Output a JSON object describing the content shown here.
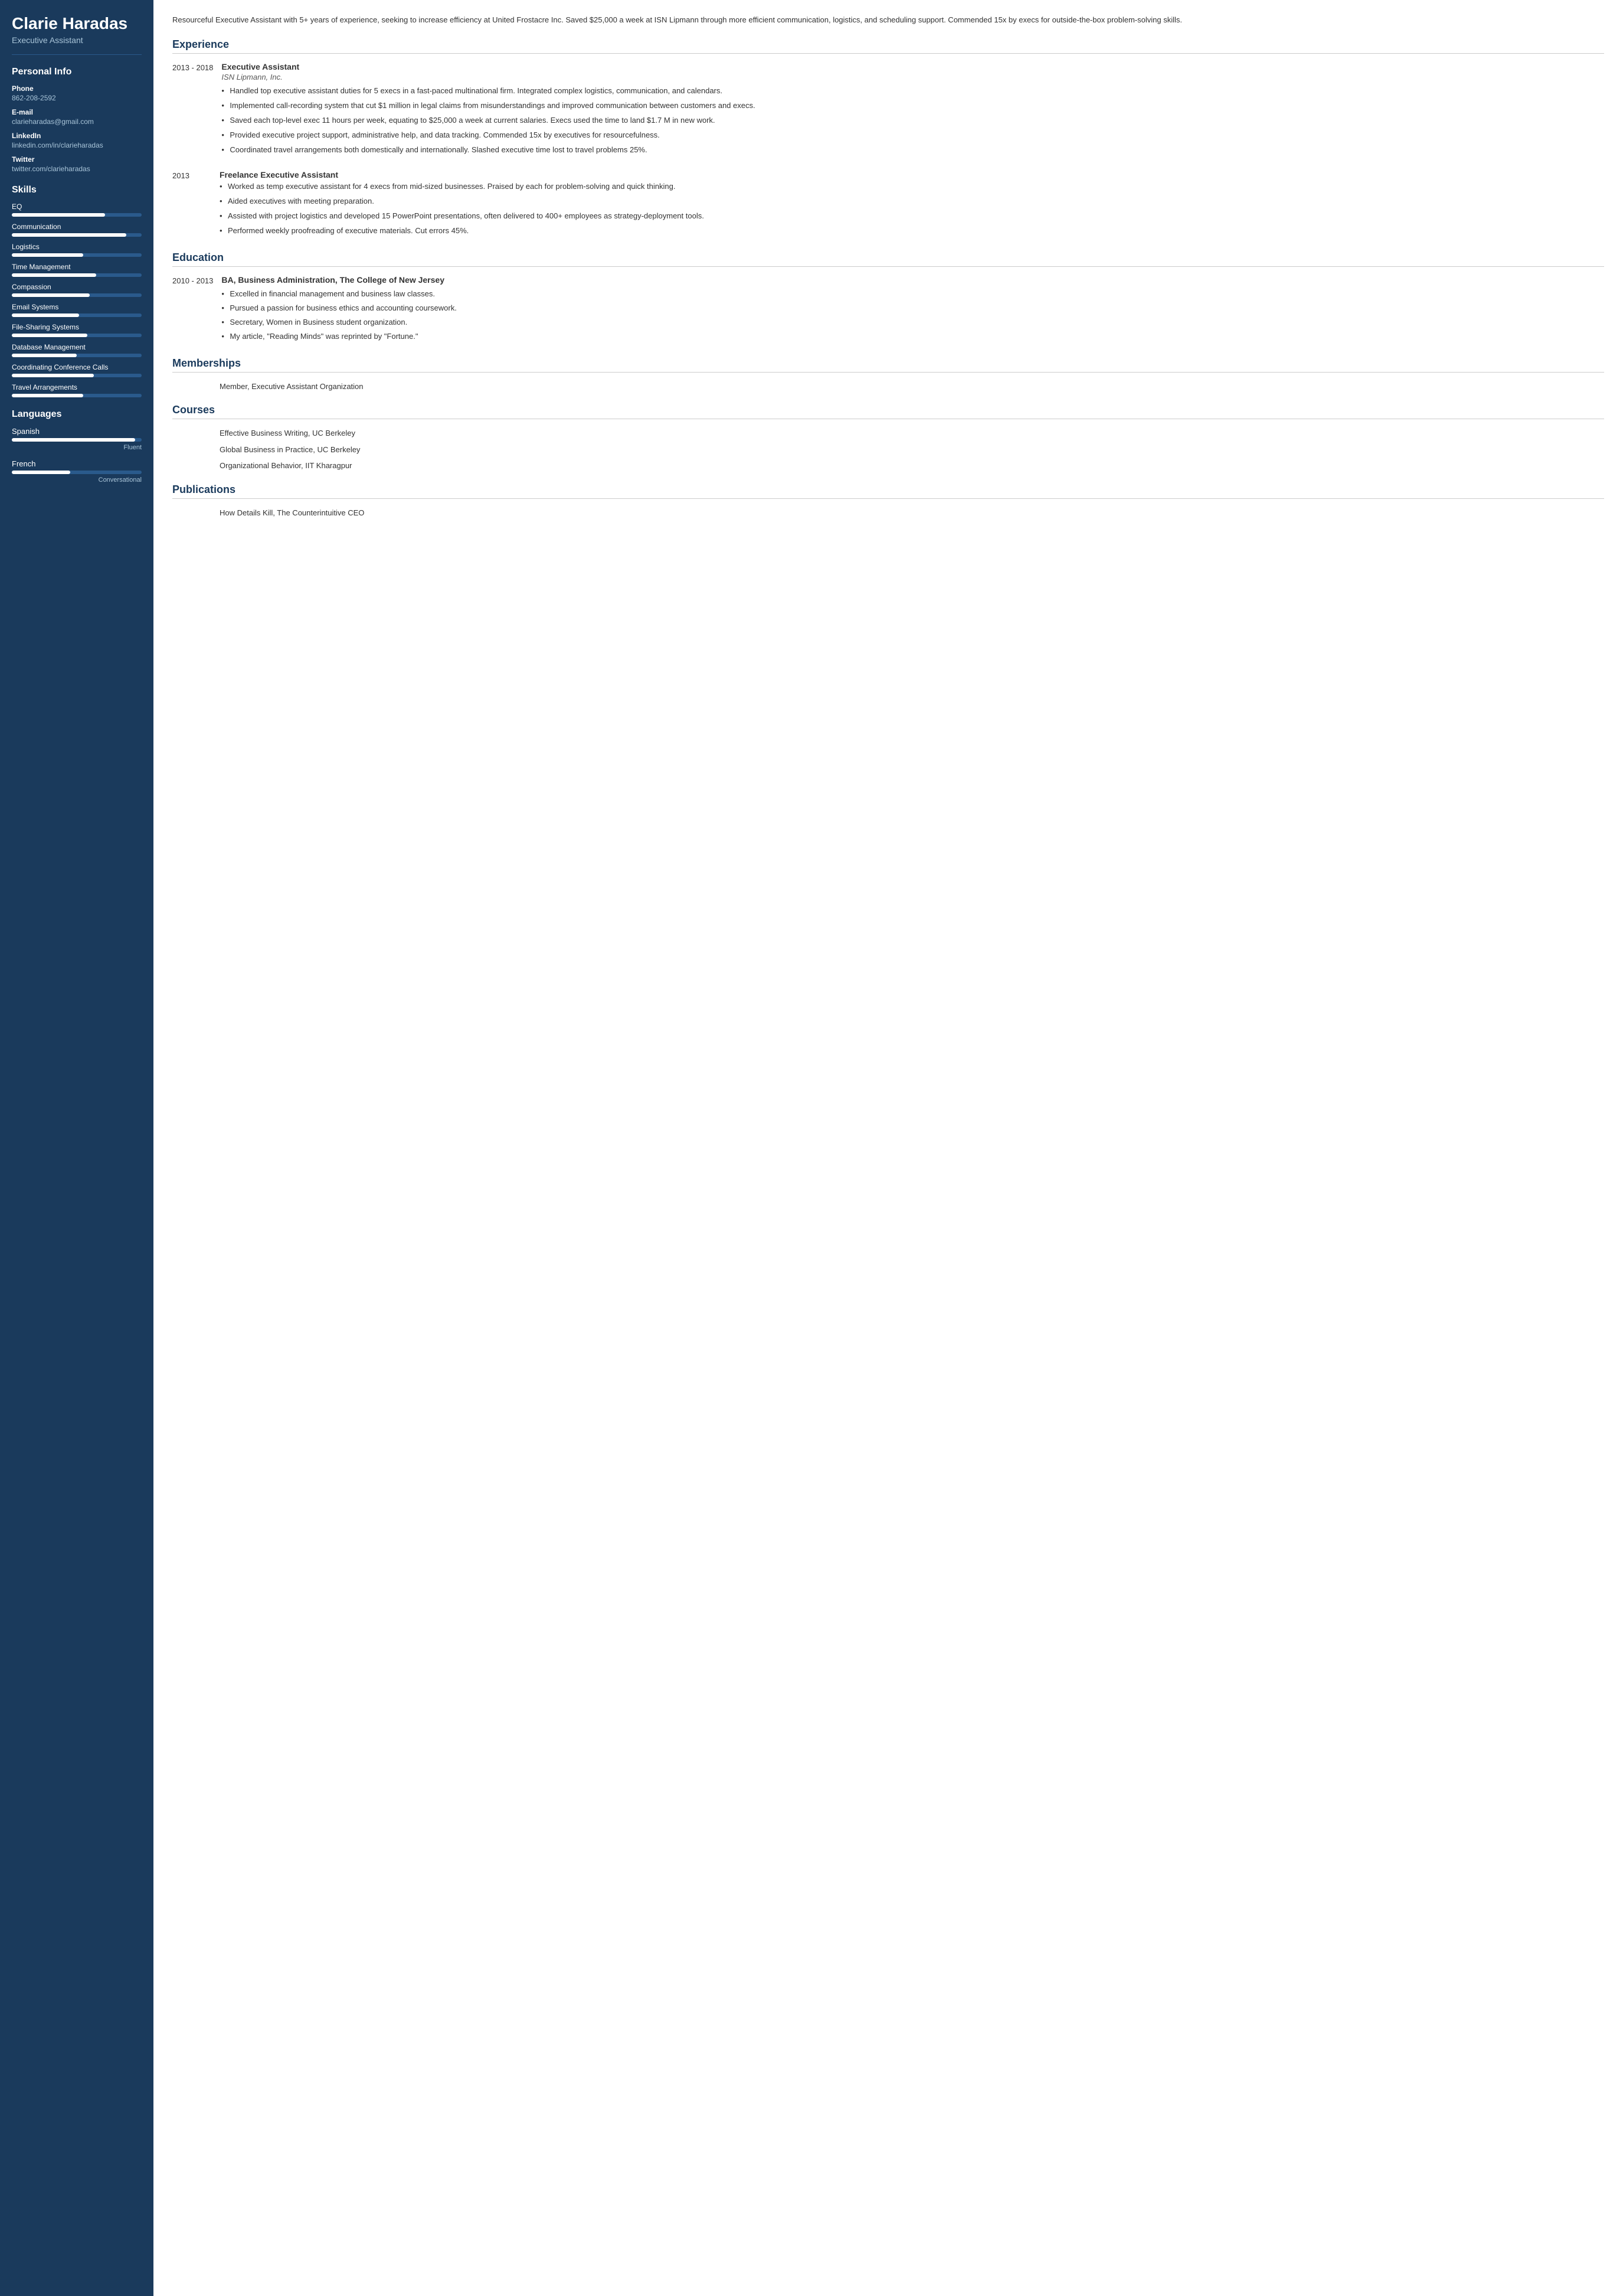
{
  "sidebar": {
    "name": "Clarie Haradas",
    "title": "Executive Assistant",
    "personal_info": {
      "section_title": "Personal Info",
      "phone_label": "Phone",
      "phone_value": "862-208-2592",
      "email_label": "E-mail",
      "email_value": "clarieharadas@gmail.com",
      "linkedin_label": "LinkedIn",
      "linkedin_value": "linkedin.com/in/clarieharadas",
      "twitter_label": "Twitter",
      "twitter_value": "twitter.com/clarieharadas"
    },
    "skills": {
      "section_title": "Skills",
      "items": [
        {
          "name": "EQ",
          "percent": 72
        },
        {
          "name": "Communication",
          "percent": 88
        },
        {
          "name": "Logistics",
          "percent": 55
        },
        {
          "name": "Time Management",
          "percent": 65
        },
        {
          "name": "Compassion",
          "percent": 60
        },
        {
          "name": "Email Systems",
          "percent": 52
        },
        {
          "name": "File-Sharing Systems",
          "percent": 58
        },
        {
          "name": "Database Management",
          "percent": 50
        },
        {
          "name": "Coordinating Conference Calls",
          "percent": 63
        },
        {
          "name": "Travel Arrangements",
          "percent": 55
        }
      ]
    },
    "languages": {
      "section_title": "Languages",
      "items": [
        {
          "name": "Spanish",
          "percent": 95,
          "level": "Fluent"
        },
        {
          "name": "French",
          "percent": 45,
          "level": "Conversational"
        }
      ]
    }
  },
  "main": {
    "summary": "Resourceful Executive Assistant with 5+ years of experience, seeking to increase efficiency at United Frostacre Inc. Saved $25,000 a week at ISN Lipmann through more efficient communication, logistics, and scheduling support. Commended 15x by execs for outside-the-box problem-solving skills.",
    "experience": {
      "section_title": "Experience",
      "items": [
        {
          "date": "2013 - 2018",
          "job_title": "Executive Assistant",
          "company": "ISN Lipmann, Inc.",
          "bullets": [
            "Handled top executive assistant duties for 5 execs in a fast-paced multinational firm. Integrated complex logistics, communication, and calendars.",
            "Implemented call-recording system that cut $1 million in legal claims from misunderstandings and improved communication between customers and execs.",
            "Saved each top-level exec 11 hours per week, equating to $25,000 a week at current salaries. Execs used the time to land $1.7 M in new work.",
            "Provided executive project support, administrative help, and data tracking. Commended 15x by executives for resourcefulness.",
            "Coordinated travel arrangements both domestically and internationally. Slashed executive time lost to travel problems 25%."
          ]
        },
        {
          "date": "2013",
          "job_title": "Freelance Executive Assistant",
          "company": "",
          "bullets": [
            "Worked as temp executive assistant for 4 execs from mid-sized businesses. Praised by each for problem-solving and quick thinking.",
            "Aided executives with meeting preparation.",
            "Assisted with project logistics and developed 15 PowerPoint presentations, often delivered to 400+ employees as strategy-deployment tools.",
            "Performed weekly proofreading of executive materials. Cut errors 45%."
          ]
        }
      ]
    },
    "education": {
      "section_title": "Education",
      "items": [
        {
          "date": "2010 - 2013",
          "degree": "BA, Business Administration, The College of New Jersey",
          "bullets": [
            "Excelled in financial management and business law classes.",
            "Pursued a passion for business ethics and accounting coursework.",
            "Secretary, Women in Business student organization.",
            "My article, \"Reading Minds\" was reprinted by \"Fortune.\""
          ]
        }
      ]
    },
    "memberships": {
      "section_title": "Memberships",
      "items": [
        "Member, Executive Assistant Organization"
      ]
    },
    "courses": {
      "section_title": "Courses",
      "items": [
        "Effective Business Writing, UC Berkeley",
        "Global Business in Practice, UC Berkeley",
        "Organizational Behavior, IIT Kharagpur"
      ]
    },
    "publications": {
      "section_title": "Publications",
      "items": [
        "How Details Kill, The Counterintuitive CEO"
      ]
    }
  }
}
